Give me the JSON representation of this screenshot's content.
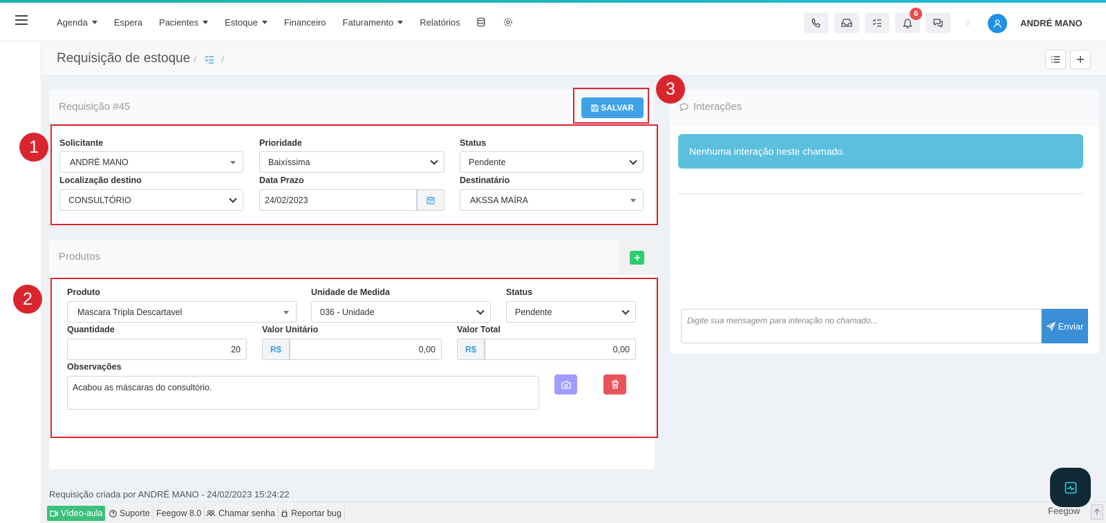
{
  "nav": {
    "menu": [
      {
        "label": "Agenda",
        "dropdown": true
      },
      {
        "label": "Espera",
        "dropdown": false
      },
      {
        "label": "Pacientes",
        "dropdown": true
      },
      {
        "label": "Estoque",
        "dropdown": true
      },
      {
        "label": "Financeiro",
        "dropdown": false
      },
      {
        "label": "Faturamento",
        "dropdown": true
      },
      {
        "label": "Relatórios",
        "dropdown": false
      }
    ],
    "notifications_count": "6",
    "username": "ANDRÉ MANO"
  },
  "header": {
    "title": "Requisição de estoque",
    "sep1": "/",
    "sep2": "/"
  },
  "requisition": {
    "title": "Requisição #45",
    "save_label": "SALVAR",
    "solicitante_label": "Solicitante",
    "solicitante_value": "ANDRÉ MANO",
    "prioridade_label": "Prioridade",
    "prioridade_value": "Baixíssima",
    "status_label": "Status",
    "status_value": "Pendente",
    "localizacao_label": "Localização destino",
    "localizacao_value": "CONSULTÓRIO",
    "prazo_label": "Data Prazo",
    "prazo_value": "24/02/2023",
    "destinatario_label": "Destinatário",
    "destinatario_value": "AKSSA MAÍRA"
  },
  "products": {
    "title": "Produtos",
    "produto_label": "Produto",
    "produto_value": "Mascara Tripla Descartavel",
    "unidade_label": "Unidade de Medida",
    "unidade_value": "036 - Unidade",
    "status_label": "Status",
    "status_value": "Pendente",
    "quantidade_label": "Quantidade",
    "quantidade_value": "20",
    "valor_unit_label": "Valor Unitário",
    "valor_unit_value": "0,00",
    "valor_total_label": "Valor Total",
    "valor_total_value": "0,00",
    "currency": "R$",
    "obs_label": "Observações",
    "obs_value": "Acabou as máscaras do consultório."
  },
  "interactions": {
    "title": "Interações",
    "empty_message": "Nenhuma interação neste chamado.",
    "placeholder": "Digite sua mensagem para interação no chamado...",
    "send_label": "Enviar"
  },
  "annotations": [
    "1",
    "2",
    "3"
  ],
  "footer": {
    "created_note": "Requisição criada por ANDRÉ MANO - 24/02/2023 15:24:22",
    "video": "Vídeo-aula",
    "support": "Suporte",
    "version": "Feegow 8.0",
    "call": "Chamar senha",
    "bug": "Reportar bug",
    "brand": "Feegow"
  },
  "colors": {
    "accent": "#3fa2e8",
    "annotation": "#d9262e",
    "alert": "#5bc0de",
    "add": "#2ecc71",
    "camera": "#a29bfe",
    "delete": "#e8545a"
  }
}
